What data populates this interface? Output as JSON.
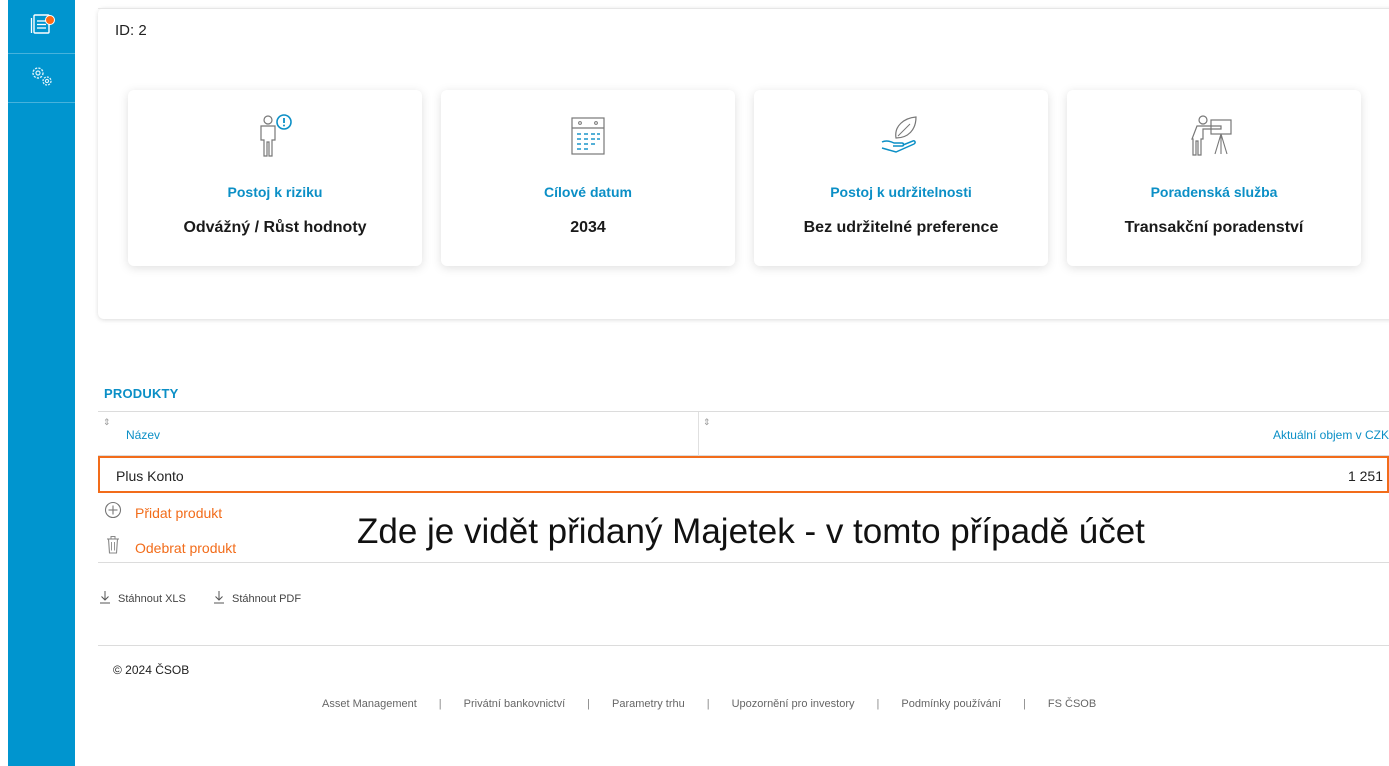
{
  "sidebar": {
    "items": [
      {
        "icon": "document-list-icon",
        "badge_color": "#ff6a13"
      },
      {
        "icon": "gears-icon"
      }
    ],
    "color": "#0095cf"
  },
  "header": {
    "id_label": "ID: 2"
  },
  "profile_tiles": [
    {
      "icon": "person-alert-icon",
      "title": "Postoj k riziku",
      "value": "Odvážný / Růst hodnoty"
    },
    {
      "icon": "calendar-icon",
      "title": "Cílové datum",
      "value": "2034"
    },
    {
      "icon": "hand-leaf-icon",
      "title": "Postoj k udržitelnosti",
      "value": "Bez udržitelné preference"
    },
    {
      "icon": "presenter-board-icon",
      "title": "Poradenská služba",
      "value": "Transakční poradenství"
    }
  ],
  "products": {
    "title": "PRODUKTY",
    "columns": [
      "Název",
      "Aktuální objem v CZK"
    ],
    "rows": [
      {
        "name": "Plus Konto",
        "volume": "1 251"
      }
    ],
    "add_label": "Přidat produkt",
    "remove_label": "Odebrat produkt"
  },
  "overlay_caption": "Zde je vidět přidaný Majetek  - v tomto případě účet",
  "downloads": {
    "xls": "Stáhnout XLS",
    "pdf": "Stáhnout PDF"
  },
  "footer": {
    "copyright": "© 2024 ČSOB",
    "links": [
      "Asset Management",
      "Privátní bankovnictví",
      "Parametry trhu",
      "Upozornění pro investory",
      "Podmínky používání",
      "FS ČSOB"
    ],
    "separator": "|"
  },
  "colors": {
    "accent_blue": "#0b8fc6",
    "accent_orange": "#f26c1a"
  }
}
